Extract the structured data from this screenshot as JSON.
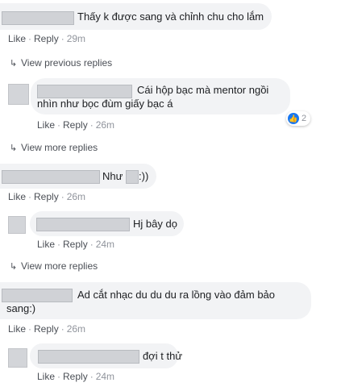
{
  "actions": {
    "like": "Like",
    "reply": "Reply",
    "sep": "·"
  },
  "comments": [
    {
      "text": "Thấy k được sang và chỉnh chu cho lắm",
      "time": "29m"
    },
    {
      "text": "Cái hộp bạc mà mentor ngồi nhìn như bọc đùm giấy bạc á",
      "time": "26m",
      "reactions": "2"
    },
    {
      "text_before": "Như",
      "text_after": ":))",
      "time": "26m"
    },
    {
      "text": "Hj bây dọ",
      "time": "24m"
    },
    {
      "text": "Ad cắt nhạc du du du ra lồng vào đảm bảo sang:)",
      "time": "26m"
    },
    {
      "text": "đợi t thử",
      "time": "24m"
    }
  ],
  "view_previous": "View previous replies",
  "view_more_1": "View more replies",
  "view_more_2": "View more replies",
  "colors": {
    "bubble": "#f2f3f5",
    "link": "#4b4f56",
    "time": "#90949c",
    "like_blue": "#1877f2"
  }
}
